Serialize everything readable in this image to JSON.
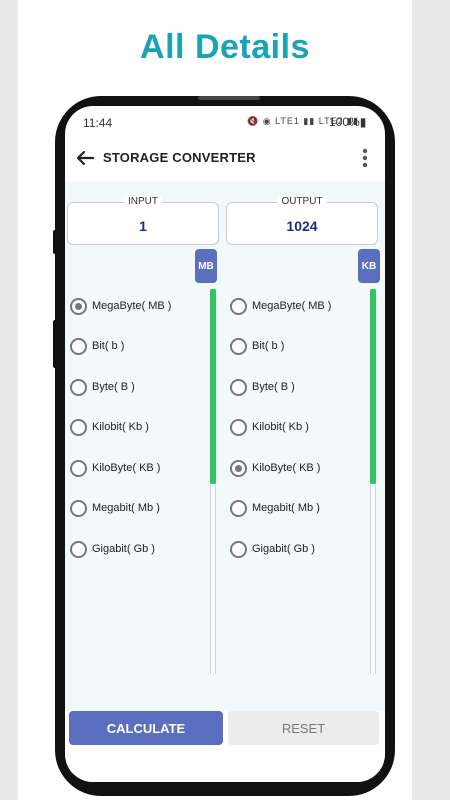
{
  "headline": "All Details",
  "status": {
    "time": "11:44",
    "icons": "🔇 ◉ LTE1 ▮▮ LTE2 ▮▮",
    "battery": "100%▮"
  },
  "appbar": {
    "title": "STORAGE CONVERTER"
  },
  "input": {
    "label": "INPUT",
    "value": "1",
    "unit_badge": "MB"
  },
  "output": {
    "label": "OUTPUT",
    "value": "1024",
    "unit_badge": "KB"
  },
  "input_units": [
    {
      "label": "MegaByte( MB )",
      "checked": true
    },
    {
      "label": "Bit( b )",
      "checked": false
    },
    {
      "label": "Byte( B )",
      "checked": false
    },
    {
      "label": "Kilobit( Kb )",
      "checked": false
    },
    {
      "label": "KiloByte( KB )",
      "checked": false
    },
    {
      "label": "Megabit( Mb )",
      "checked": false
    },
    {
      "label": "Gigabit( Gb )",
      "checked": false
    }
  ],
  "output_units": [
    {
      "label": "MegaByte( MB )",
      "checked": false
    },
    {
      "label": "Bit( b )",
      "checked": false
    },
    {
      "label": "Byte( B )",
      "checked": false
    },
    {
      "label": "Kilobit( Kb )",
      "checked": false
    },
    {
      "label": "KiloByte( KB )",
      "checked": true
    },
    {
      "label": "Megabit( Mb )",
      "checked": false
    },
    {
      "label": "Gigabit( Gb )",
      "checked": false
    }
  ],
  "buttons": {
    "calculate": "CALCULATE",
    "reset": "RESET"
  },
  "colors": {
    "accent": "#5b6fc0",
    "headline": "#19a3b5",
    "scroll": "#35c166",
    "value": "#1c2a8c"
  }
}
